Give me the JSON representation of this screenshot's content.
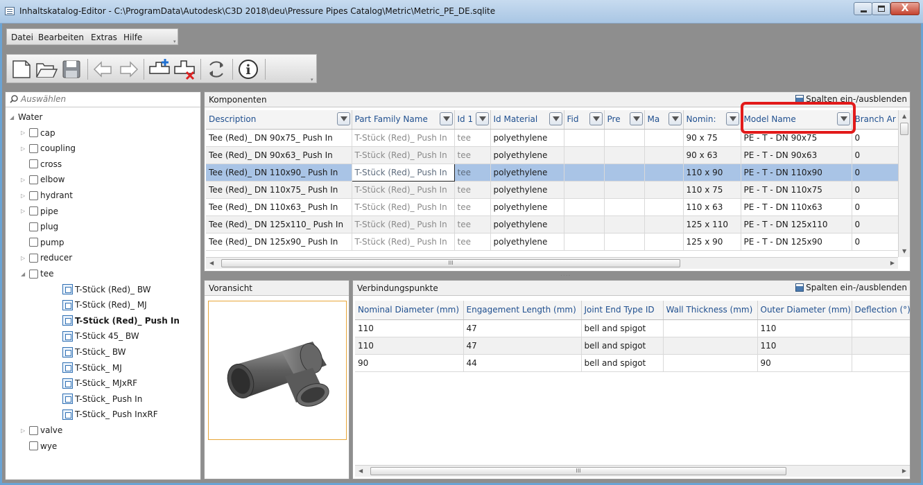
{
  "window": {
    "title": "Inhaltskatalog-Editor - C:\\ProgramData\\Autodesk\\C3D 2018\\deu\\Pressure Pipes Catalog\\Metric\\Metric_PE_DE.sqlite",
    "close_label": "X"
  },
  "menu": [
    "Datei",
    "Bearbeiten",
    "Extras",
    "Hilfe"
  ],
  "toolbar": {
    "buttons": [
      "new-icon",
      "open-icon",
      "save-icon",
      "undo-icon",
      "redo-icon",
      "add-part-icon",
      "delete-part-icon",
      "refresh-icon",
      "info-icon"
    ],
    "info_glyph": "i"
  },
  "search": {
    "placeholder": "Auswählen"
  },
  "tree": {
    "root": "Water",
    "folders": [
      "cap",
      "coupling",
      "cross",
      "elbow",
      "hydrant",
      "pipe",
      "plug",
      "pump",
      "reducer",
      "tee"
    ],
    "tee_children": [
      "T-Stück (Red)_ BW",
      "T-Stück (Red)_ MJ",
      "T-Stück (Red)_ Push In",
      "T-Stück 45_ BW",
      "T-Stück_ BW",
      "T-Stück_ MJ",
      "T-Stück_ MJxRF",
      "T-Stück_ Push In",
      "T-Stück_ Push InxRF"
    ],
    "after": [
      "valve",
      "wye"
    ],
    "selected": "T-Stück (Red)_ Push In"
  },
  "components": {
    "header": "Komponenten",
    "columns_button": "Spalten ein-/ausblenden",
    "columns": [
      "Description",
      "Part Family Name",
      "Id 1",
      "Id Material",
      "Fid",
      "Pre",
      "Ma",
      "Nomin:",
      "Model Name",
      "Branch Ar"
    ],
    "rows": [
      [
        "Tee (Red)_ DN 90x75_ Push In",
        "T-Stück (Red)_ Push In",
        "tee",
        "polyethylene",
        "",
        "",
        "",
        "90 x 75",
        "PE - T - DN 90x75",
        "0"
      ],
      [
        "Tee (Red)_ DN 90x63_ Push In",
        "T-Stück (Red)_ Push In",
        "tee",
        "polyethylene",
        "",
        "",
        "",
        "90 x 63",
        "PE - T - DN 90x63",
        "0"
      ],
      [
        "Tee (Red)_ DN 110x90_ Push In",
        "T-Stück (Red)_ Push In",
        "tee",
        "polyethylene",
        "",
        "",
        "",
        "110 x 90",
        "PE - T - DN 110x90",
        "0"
      ],
      [
        "Tee (Red)_ DN 110x75_ Push In",
        "T-Stück (Red)_ Push In",
        "tee",
        "polyethylene",
        "",
        "",
        "",
        "110 x 75",
        "PE - T - DN 110x75",
        "0"
      ],
      [
        "Tee (Red)_ DN 110x63_ Push In",
        "T-Stück (Red)_ Push In",
        "tee",
        "polyethylene",
        "",
        "",
        "",
        "110 x 63",
        "PE - T - DN 110x63",
        "0"
      ],
      [
        "Tee (Red)_ DN 125x110_ Push In",
        "T-Stück (Red)_ Push In",
        "tee",
        "polyethylene",
        "",
        "",
        "",
        "125 x 110",
        "PE - T - DN 125x110",
        "0"
      ],
      [
        "Tee (Red)_ DN 125x90_ Push In",
        "T-Stück (Red)_ Push In",
        "tee",
        "polyethylene",
        "",
        "",
        "",
        "125 x 90",
        "PE - T - DN 125x90",
        "0"
      ]
    ],
    "selected_row": 2,
    "scroll_glyph": "III"
  },
  "preview": {
    "header": "Voransicht"
  },
  "connections": {
    "header": "Verbindungspunkte",
    "columns_button": "Spalten ein-/ausblenden",
    "columns": [
      "Nominal Diameter (mm)",
      "Engagement Length (mm)",
      "Joint End Type ID",
      "Wall Thickness (mm)",
      "Outer Diameter (mm)",
      "Deflection (°)"
    ],
    "rows": [
      [
        "110",
        "47",
        "bell and spigot",
        "",
        "110",
        ""
      ],
      [
        "110",
        "47",
        "bell and spigot",
        "",
        "110",
        ""
      ],
      [
        "90",
        "44",
        "bell and spigot",
        "",
        "90",
        ""
      ]
    ],
    "scroll_glyph": "III"
  },
  "colors": {
    "highlight": "#e21a1a",
    "selection": "#a9c4e6",
    "header_text": "#1f4f8f"
  }
}
